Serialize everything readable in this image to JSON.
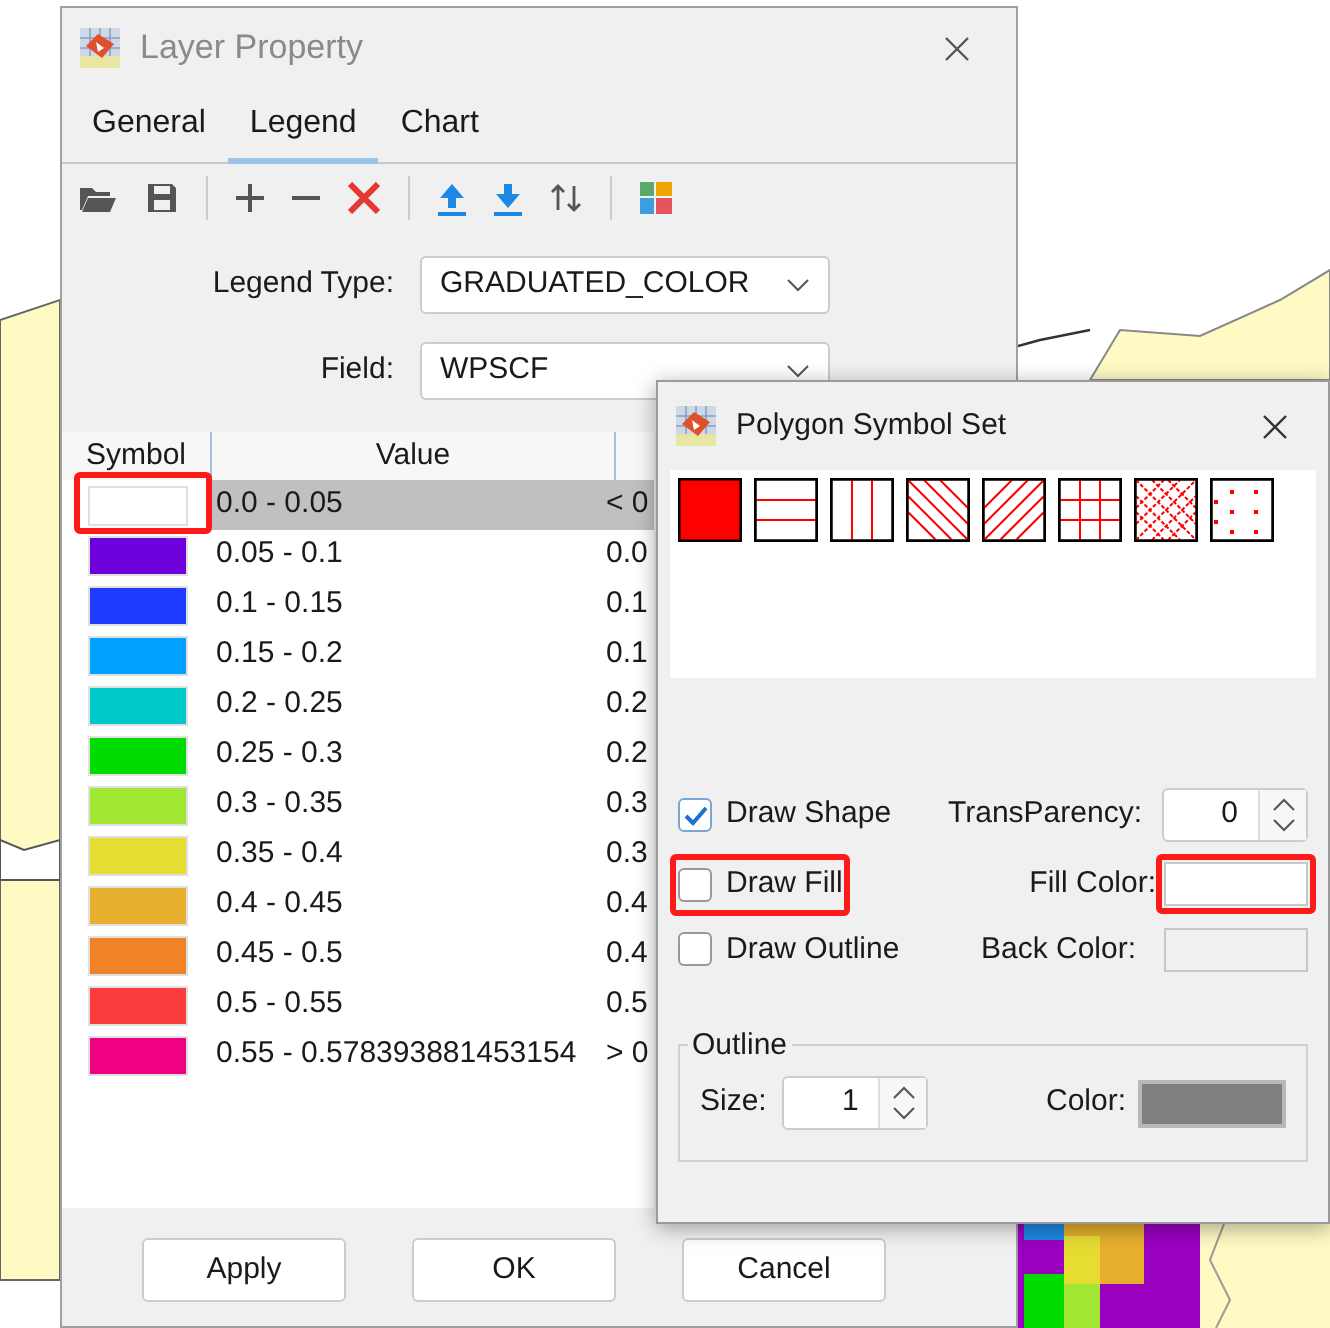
{
  "layer_dialog": {
    "title": "Layer Property",
    "tabs": [
      {
        "label": "General",
        "selected": false
      },
      {
        "label": "Legend",
        "selected": true
      },
      {
        "label": "Chart",
        "selected": false
      }
    ],
    "legend_type_label": "Legend Type:",
    "legend_type": "GRADUATED_COLOR",
    "field_label": "Field:",
    "field": "WPSCF",
    "table": {
      "columns": [
        "Symbol",
        "Value"
      ],
      "rows": [
        {
          "color": "#ffffff",
          "value": "0.0 - 0.05",
          "column_3": "< 0",
          "selected": true,
          "highlighted": true
        },
        {
          "color": "#6e00dc",
          "value": "0.05 - 0.1",
          "column_3": "0.0",
          "selected": false,
          "highlighted": false
        },
        {
          "color": "#1e3cff",
          "value": "0.1 - 0.15",
          "column_3": "0.1",
          "selected": false,
          "highlighted": false
        },
        {
          "color": "#00a0ff",
          "value": "0.15 - 0.2",
          "column_3": "0.1",
          "selected": false,
          "highlighted": false
        },
        {
          "color": "#00c8c8",
          "value": "0.2 - 0.25",
          "column_3": "0.2",
          "selected": false,
          "highlighted": false
        },
        {
          "color": "#00dc00",
          "value": "0.25 - 0.3",
          "column_3": "0.2",
          "selected": false,
          "highlighted": false
        },
        {
          "color": "#a0e632",
          "value": "0.3 - 0.35",
          "column_3": "0.3",
          "selected": false,
          "highlighted": false
        },
        {
          "color": "#e6dc32",
          "value": "0.35 - 0.4",
          "column_3": "0.3",
          "selected": false,
          "highlighted": false
        },
        {
          "color": "#e6af2d",
          "value": "0.4 - 0.45",
          "column_3": "0.4",
          "selected": false,
          "highlighted": false
        },
        {
          "color": "#f08228",
          "value": "0.45 - 0.5",
          "column_3": "0.4",
          "selected": false,
          "highlighted": false
        },
        {
          "color": "#fa3c3c",
          "value": "0.5 - 0.55",
          "column_3": "0.5",
          "selected": false,
          "highlighted": false
        },
        {
          "color": "#f00082",
          "value": "0.55 - 0.578393881453154",
          "column_3": "> 0",
          "selected": false,
          "highlighted": false
        }
      ]
    },
    "buttons": [
      "Apply",
      "OK",
      "Cancel"
    ]
  },
  "symbol_dialog": {
    "title": "Polygon Symbol Set",
    "patterns": [
      {
        "kind": "solid"
      },
      {
        "kind": "horizontal"
      },
      {
        "kind": "vertical"
      },
      {
        "kind": "backward_diagonal"
      },
      {
        "kind": "forward_diagonal"
      },
      {
        "kind": "cross"
      },
      {
        "kind": "diagonal_cross"
      },
      {
        "kind": "dots"
      }
    ],
    "draw_shape": {
      "label": "Draw Shape",
      "checked": true,
      "highlighted": false
    },
    "draw_fill": {
      "label": "Draw Fill",
      "checked": false,
      "highlighted": true
    },
    "draw_outline": {
      "label": "Draw Outline",
      "checked": false,
      "highlighted": false
    },
    "transparency": {
      "label": "TransParency:",
      "value": "0"
    },
    "fill_color": {
      "label": "Fill Color:",
      "color": "#ffffff",
      "highlighted": true
    },
    "back_color": {
      "label": "Back Color:",
      "color": "#f0f0f0",
      "highlighted": false
    },
    "outline": {
      "title": "Outline",
      "size_label": "Size:",
      "size": "1",
      "color_label": "Color:",
      "color": "#808080"
    }
  }
}
